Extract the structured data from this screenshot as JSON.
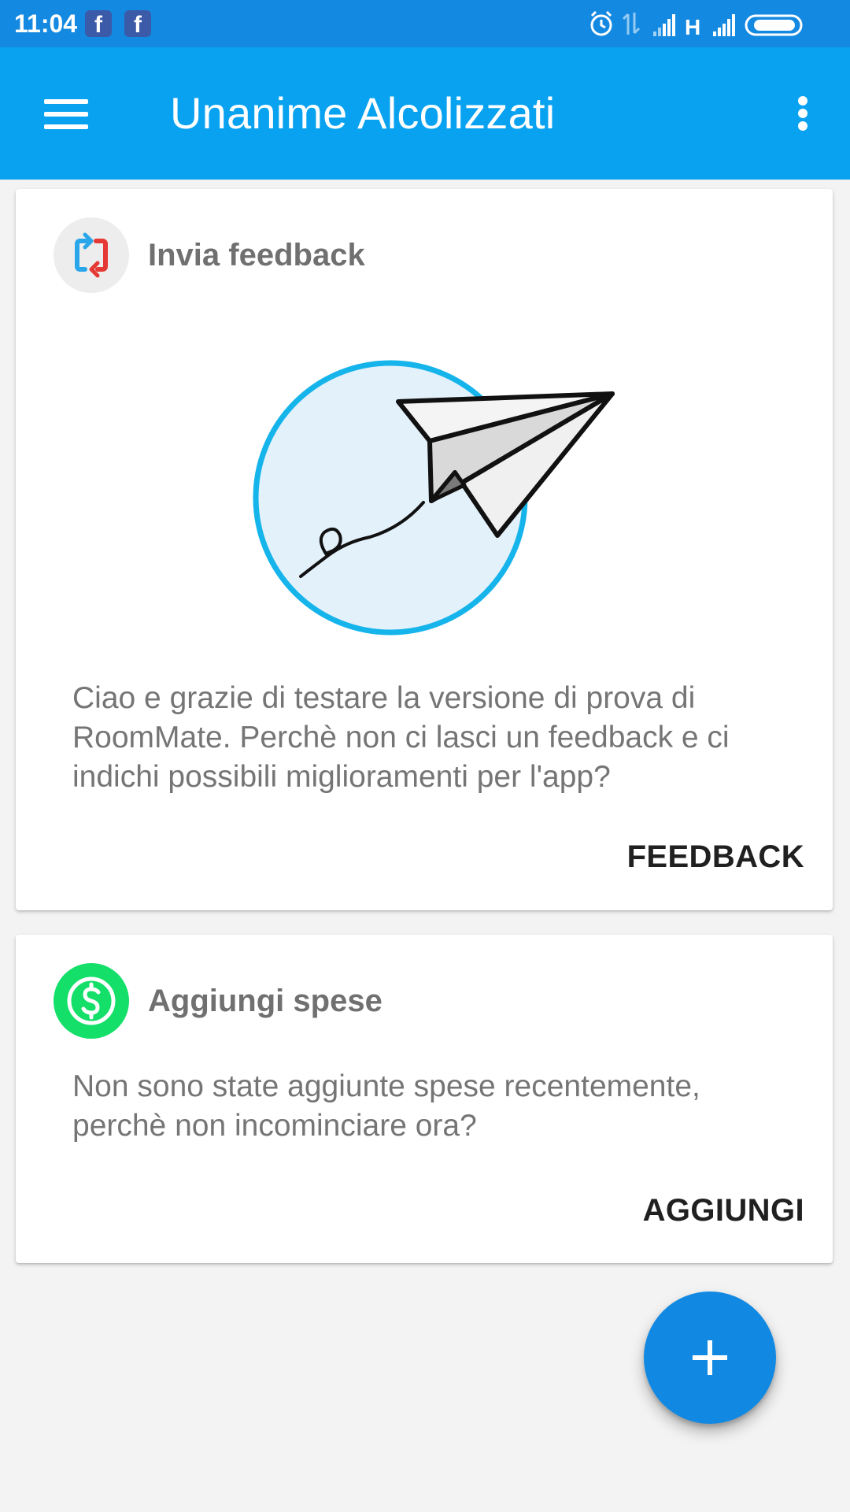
{
  "status_bar": {
    "time": "11:04",
    "notification_icons": [
      "facebook-icon",
      "facebook-icon"
    ],
    "system_icons": [
      "alarm-icon",
      "data-arrows-icon",
      "signal-icon",
      "network-type-icon",
      "signal-icon",
      "battery-icon"
    ],
    "network_type": "H",
    "facebook_glyph": "f"
  },
  "app_bar": {
    "title": "Unanime Alcolizzati",
    "menu_icon": "hamburger-menu-icon",
    "overflow_icon": "more-vert-icon"
  },
  "cards": {
    "feedback": {
      "icon": "sync-arrows-icon",
      "title": "Invia feedback",
      "illustration": "paper-plane-icon",
      "body": "Ciao e grazie di testare la versione di prova di RoomMate. Perchè non ci lasci un feedback e ci indichi possibili miglioramenti per l'app?",
      "action_label": "FEEDBACK"
    },
    "expenses": {
      "icon": "dollar-icon",
      "title": "Aggiungi spese",
      "body": "Non sono state aggiunte spese recentemente, perchè non incominciare ora?",
      "action_label": "AGGIUNGI"
    }
  },
  "fab": {
    "icon": "plus-icon"
  },
  "colors": {
    "status_bar": "#1489e1",
    "app_bar": "#08a2f0",
    "background": "#f3f3f3",
    "fab": "#1189e3",
    "expenses_icon": "#13df69",
    "illustration_ring": "#15b4ea",
    "illustration_fill": "#e3f1fb"
  }
}
